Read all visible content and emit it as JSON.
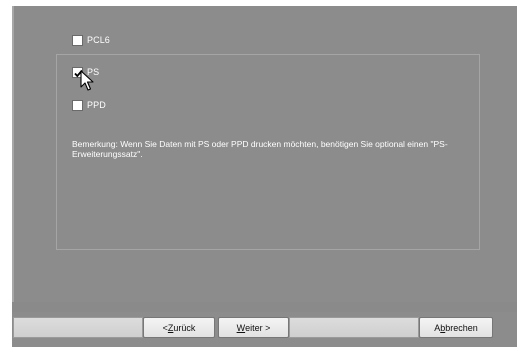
{
  "options": [
    {
      "label": "PCL6",
      "checked": false
    },
    {
      "label": "PS",
      "checked": true
    },
    {
      "label": "PPD",
      "checked": false
    }
  ],
  "remark": "Bemerkung: Wenn Sie Daten mit PS oder PPD drucken möchten, benötigen Sie optional einen \"PS-Erweiterungssatz\".",
  "buttons": {
    "back_prefix": "< ",
    "back_mnemonic": "Z",
    "back_rest": "urück",
    "next_mnemonic": "W",
    "next_rest": "eiter >",
    "cancel_prefix": "A",
    "cancel_mnemonic": "b",
    "cancel_rest": "brechen"
  },
  "colors": {
    "panel": "#8c8c8c",
    "text": "#ffffff",
    "button_face": "#ececec"
  },
  "icons": {
    "cursor": "mouse-pointer-icon",
    "check": "check-mark-icon"
  }
}
